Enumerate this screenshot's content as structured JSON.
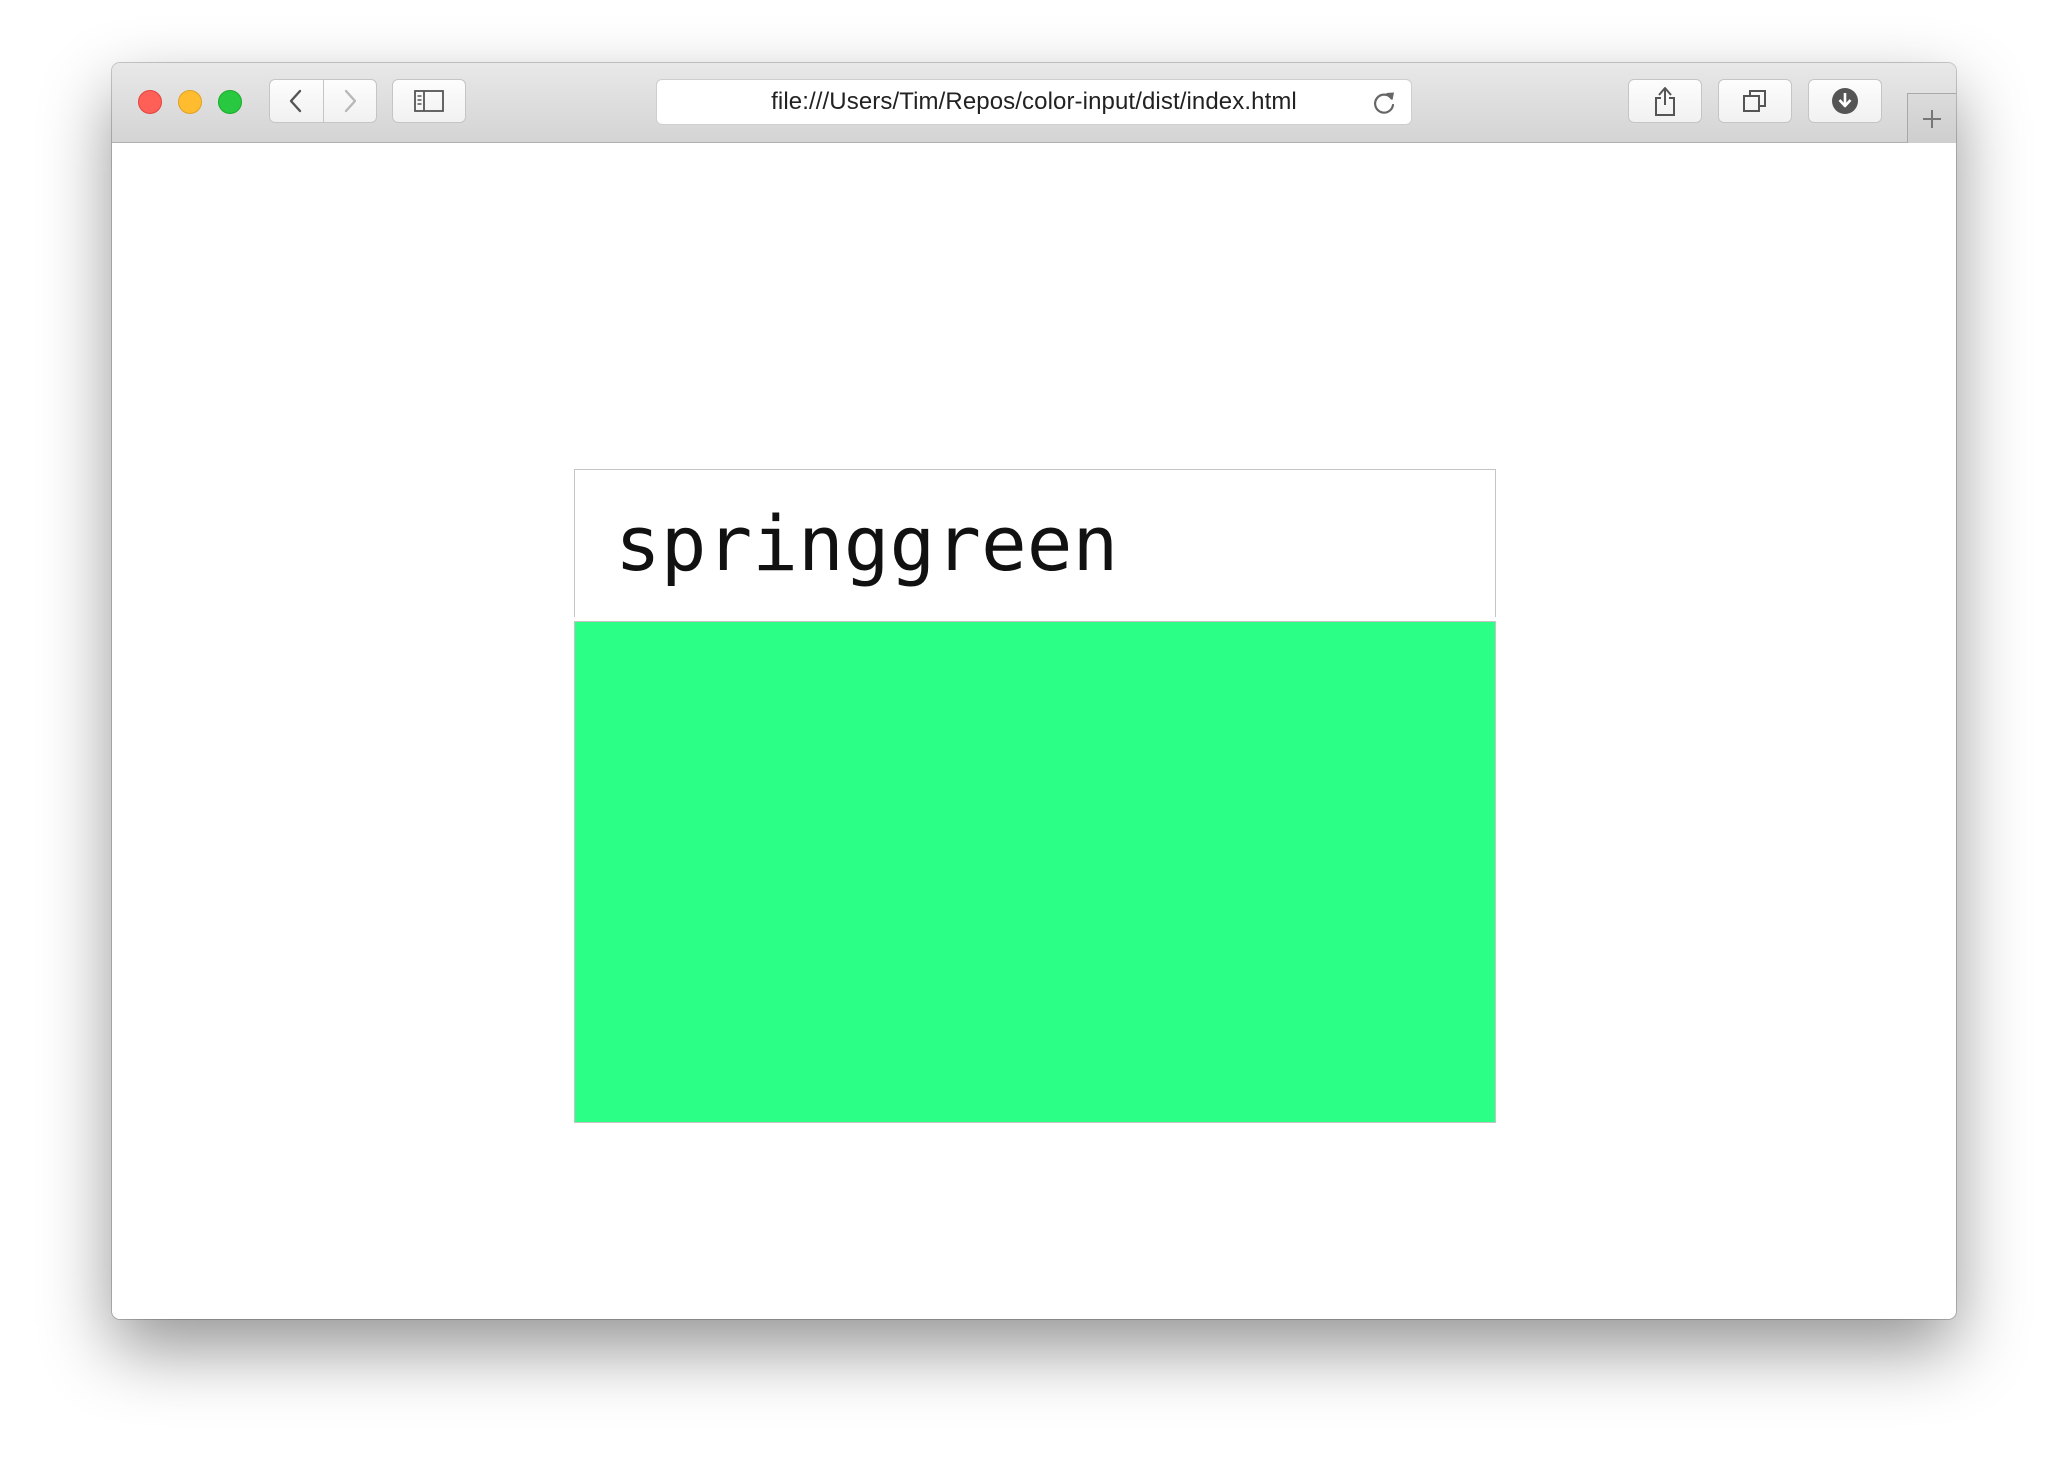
{
  "browser": {
    "url": "file:///Users/Tim/Repos/color-input/dist/index.html",
    "icons": {
      "close": "close-window-icon",
      "minimize": "minimize-window-icon",
      "zoom": "zoom-window-icon",
      "back": "chevron-left-icon",
      "forward": "chevron-right-icon",
      "sidebar": "sidebar-icon",
      "reload": "reload-icon",
      "share": "share-icon",
      "tabs": "tabs-overview-icon",
      "downloads": "download-icon",
      "new_tab": "plus-icon"
    },
    "colors": {
      "close": "#fe5f57",
      "minimize": "#febc2e",
      "zoom": "#28c840"
    }
  },
  "page": {
    "color_input": {
      "value": "springgreen"
    },
    "swatch": {
      "color": "#2cff86"
    }
  }
}
